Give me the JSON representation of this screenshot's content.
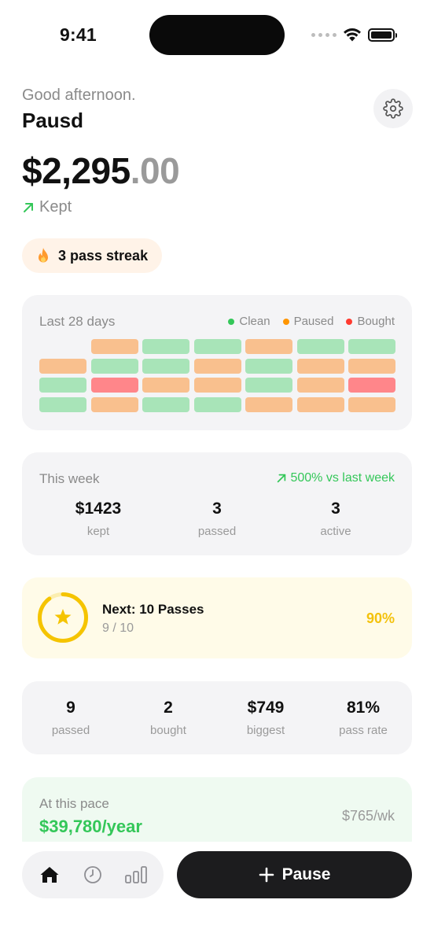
{
  "status_bar": {
    "time": "9:41"
  },
  "header": {
    "greeting": "Good afternoon.",
    "username": "Pausd",
    "settings_icon": "gear-icon"
  },
  "balance": {
    "whole": "$2,295",
    "cents": ".00",
    "label": "Kept",
    "trend_icon": "arrow-up-right-icon"
  },
  "streak": {
    "label": "3 pass streak",
    "icon": "flame-icon"
  },
  "heatmap": {
    "title": "Last 28 days",
    "legend": [
      {
        "label": "Clean",
        "color": "#34c759"
      },
      {
        "label": "Paused",
        "color": "#ff9500"
      },
      {
        "label": "Bought",
        "color": "#ff3b30"
      }
    ],
    "colors": {
      "clean": "#a8e4b8",
      "paused": "#f9c08e",
      "bought": "#ff868a",
      "empty": "transparent"
    },
    "rows": [
      [
        "empty",
        "paused",
        "clean",
        "clean",
        "paused",
        "clean",
        "clean"
      ],
      [
        "paused",
        "clean",
        "clean",
        "paused",
        "clean",
        "paused",
        "paused"
      ],
      [
        "clean",
        "bought",
        "paused",
        "paused",
        "clean",
        "paused",
        "bought"
      ],
      [
        "clean",
        "paused",
        "clean",
        "clean",
        "paused",
        "paused",
        "paused"
      ]
    ]
  },
  "week": {
    "title": "This week",
    "trend": "500% vs last week",
    "stats": [
      {
        "value": "$1423",
        "label": "kept"
      },
      {
        "value": "3",
        "label": "passed"
      },
      {
        "value": "3",
        "label": "active"
      }
    ]
  },
  "goal": {
    "title": "Next: 10 Passes",
    "progress_text": "9 / 10",
    "percent_text": "90%",
    "progress": 0.9,
    "icon": "star-icon"
  },
  "totals": [
    {
      "value": "9",
      "label": "passed"
    },
    {
      "value": "2",
      "label": "bought"
    },
    {
      "value": "$749",
      "label": "biggest"
    },
    {
      "value": "81%",
      "label": "pass rate"
    }
  ],
  "pace": {
    "label": "At this pace",
    "yearly": "$39,780/year",
    "weekly": "$765/wk"
  },
  "nav": {
    "tabs": [
      {
        "icon": "home-icon"
      },
      {
        "icon": "clock-icon"
      },
      {
        "icon": "bar-chart-icon"
      }
    ],
    "pause_label": "Pause"
  }
}
